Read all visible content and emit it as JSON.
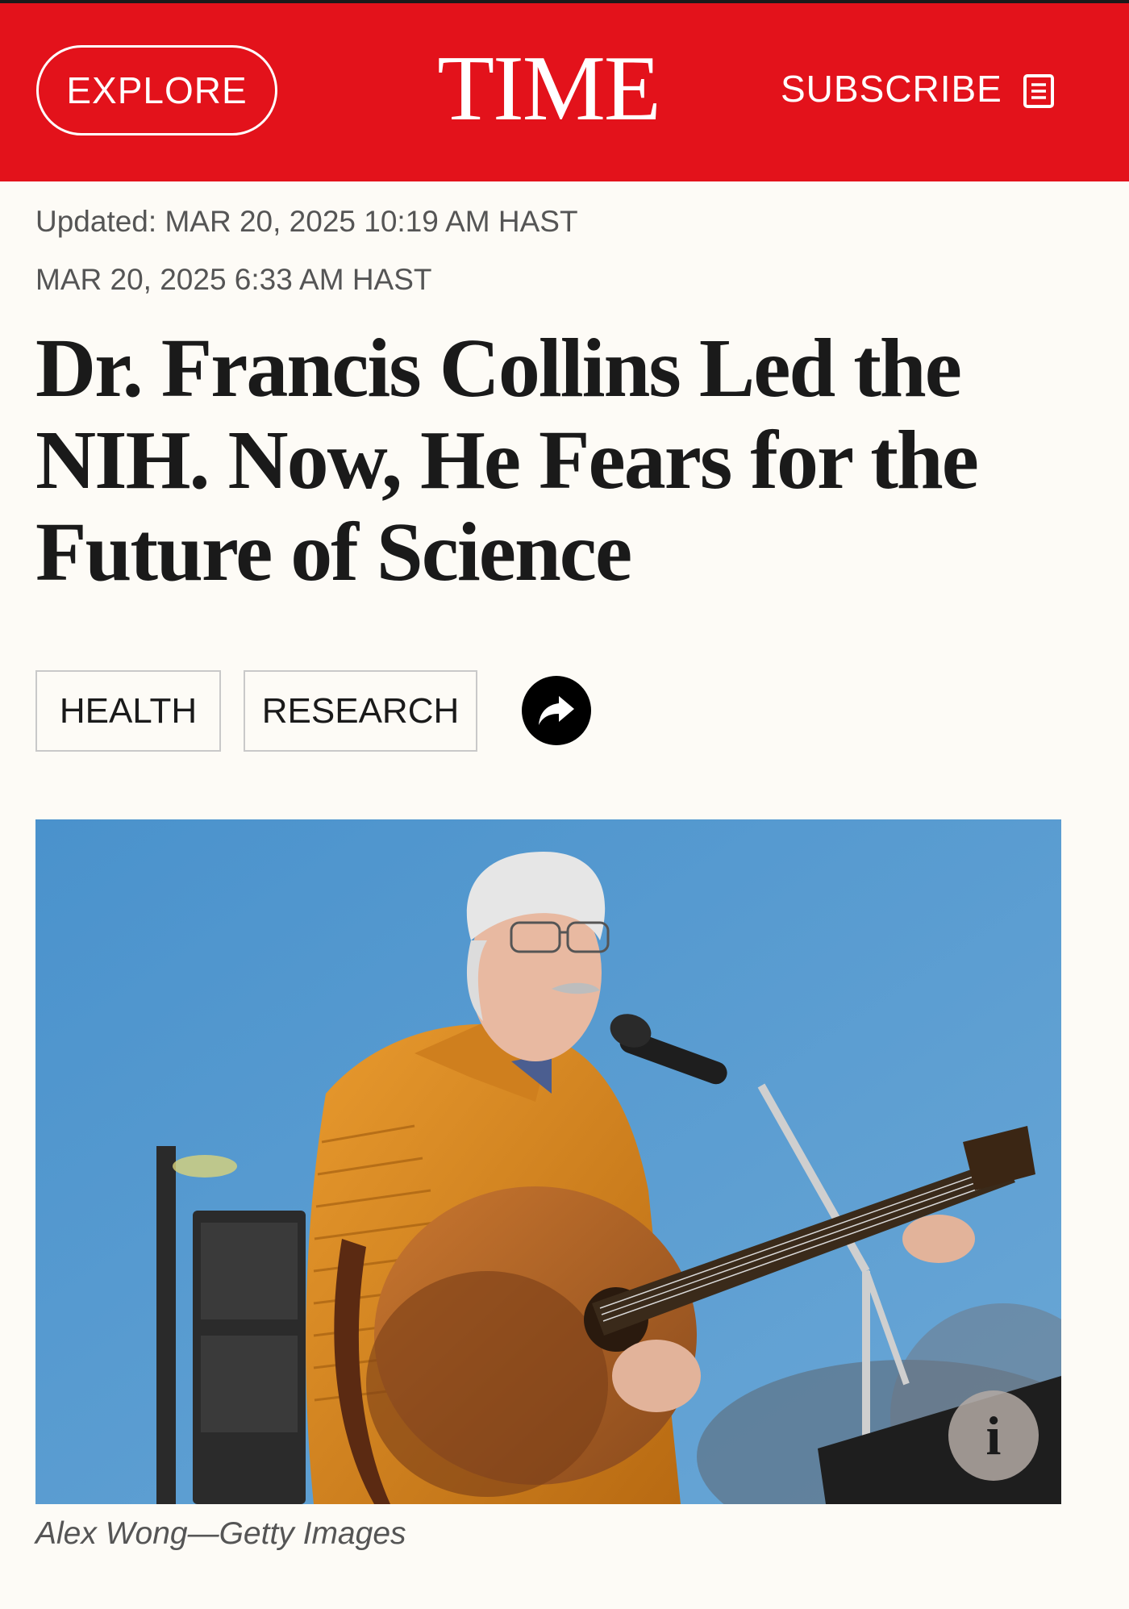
{
  "header": {
    "explore_label": "EXPLORE",
    "logo_text": "TIME",
    "subscribe_label": "SUBSCRIBE",
    "subscribe_icon": "newspaper-icon",
    "brand_color": "#e3121b"
  },
  "article": {
    "updated": "Updated: MAR 20, 2025 10:19 AM HAST",
    "published": "MAR 20, 2025 6:33 AM HAST",
    "headline": "Dr. Francis Collins Led the NIH. Now, He Fears for the Future of Science",
    "tags": [
      "HEALTH",
      "RESEARCH"
    ],
    "share_icon": "share-arrow-icon"
  },
  "photo": {
    "info_label": "i",
    "caption": "Alex Wong—Getty Images"
  }
}
